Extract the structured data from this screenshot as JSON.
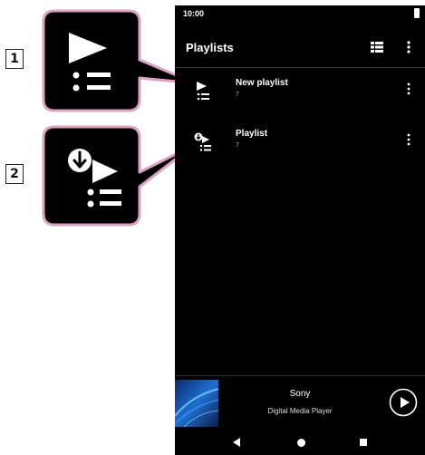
{
  "callouts": [
    {
      "number": "1",
      "icon": "playlist-icon"
    },
    {
      "number": "2",
      "icon": "downloaded-playlist-icon"
    }
  ],
  "status_bar": {
    "time": "10:00"
  },
  "app_bar": {
    "title": "Playlists",
    "list_icon": "list-view-icon",
    "more_icon": "more-vert-icon"
  },
  "playlists": [
    {
      "name": "New playlist",
      "count": "7",
      "icon": "playlist-icon"
    },
    {
      "name": "Playlist",
      "count": "7",
      "icon": "downloaded-playlist-icon"
    }
  ],
  "mini_player": {
    "title": "Sony",
    "subtitle": "Digital Media Player",
    "play_icon": "play-icon"
  },
  "nav_bar": {
    "back": "back-icon",
    "home": "home-icon",
    "recent": "recent-apps-icon"
  },
  "colors": {
    "callout_border": "#d9a3c0",
    "callout_fill": "#000000",
    "phone_bg": "#000000"
  }
}
